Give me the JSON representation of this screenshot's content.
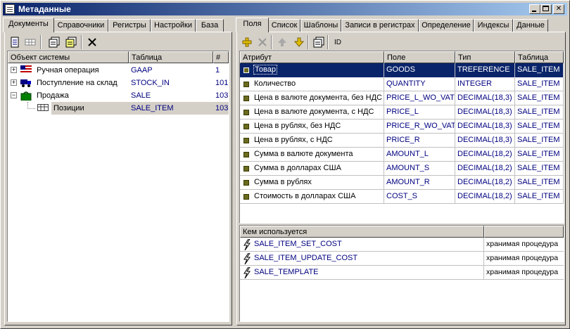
{
  "window": {
    "title": "Метаданные"
  },
  "left_tabs": [
    {
      "label": "Документы",
      "active": true
    },
    {
      "label": "Справочники"
    },
    {
      "label": "Регистры"
    },
    {
      "label": "Настройки"
    },
    {
      "label": "База"
    }
  ],
  "right_tabs": [
    {
      "label": "Поля",
      "active": true
    },
    {
      "label": "Список"
    },
    {
      "label": "Шаблоны"
    },
    {
      "label": "Записи в регистрах"
    },
    {
      "label": "Определение"
    },
    {
      "label": "Индексы"
    },
    {
      "label": "Данные"
    }
  ],
  "left_toolbar": [
    "new-document-icon",
    "grid-icon",
    "properties-icon",
    "properties-alt-icon",
    "delete-icon"
  ],
  "right_toolbar": {
    "icons": [
      "add-icon",
      "delete-icon",
      "move-up-icon",
      "move-down-icon",
      "properties-icon"
    ],
    "id_label": "ID"
  },
  "tree": {
    "headers": {
      "object": "Объект системы",
      "table": "Таблица",
      "num": "#"
    },
    "rows": [
      {
        "name": "Ручная операция",
        "table": "GAAP",
        "num": "1",
        "icon": "flag-icon",
        "level": 0,
        "expander": "+"
      },
      {
        "name": "Поступление на склад",
        "table": "STOCK_IN",
        "num": "101",
        "icon": "truck-icon",
        "level": 0,
        "expander": "+"
      },
      {
        "name": "Продажа",
        "table": "SALE",
        "num": "103",
        "icon": "bag-icon",
        "level": 0,
        "expander": "−"
      },
      {
        "name": "Позиции",
        "table": "SALE_ITEM",
        "num": "103",
        "icon": "table-icon",
        "level": 1,
        "selected": true
      }
    ]
  },
  "fields": {
    "headers": {
      "attribute": "Атрибут",
      "field": "Поле",
      "type": "Тип",
      "table": "Таблица"
    },
    "rows": [
      {
        "attribute": "Товар",
        "field": "GOODS",
        "type": "TREFERENCE",
        "table": "SALE_ITEM",
        "selected": true
      },
      {
        "attribute": "Количество",
        "field": "QUANTITY",
        "type": "INTEGER",
        "table": "SALE_ITEM"
      },
      {
        "attribute": "Цена в валюте документа, без НДС",
        "field": "PRICE_L_WO_VAT",
        "type": "DECIMAL(18,3)",
        "table": "SALE_ITEM"
      },
      {
        "attribute": "Цена в валюте документа, с НДС",
        "field": "PRICE_L",
        "type": "DECIMAL(18,3)",
        "table": "SALE_ITEM"
      },
      {
        "attribute": "Цена в рублях, без НДС",
        "field": "PRICE_R_WO_VAT",
        "type": "DECIMAL(18,3)",
        "table": "SALE_ITEM"
      },
      {
        "attribute": "Цена в рублях, с НДС",
        "field": "PRICE_R",
        "type": "DECIMAL(18,3)",
        "table": "SALE_ITEM"
      },
      {
        "attribute": "Сумма в валюте документа",
        "field": "AMOUNT_L",
        "type": "DECIMAL(18,2)",
        "table": "SALE_ITEM"
      },
      {
        "attribute": "Сумма в долларах США",
        "field": "AMOUNT_S",
        "type": "DECIMAL(18,2)",
        "table": "SALE_ITEM"
      },
      {
        "attribute": "Сумма в рублях",
        "field": "AMOUNT_R",
        "type": "DECIMAL(18,2)",
        "table": "SALE_ITEM"
      },
      {
        "attribute": "Стоимость в долларах США",
        "field": "COST_S",
        "type": "DECIMAL(18,2)",
        "table": "SALE_ITEM"
      }
    ]
  },
  "usage": {
    "header": "Кем используется",
    "rows": [
      {
        "name": "SALE_ITEM_SET_COST",
        "kind": "хранимая процедура"
      },
      {
        "name": "SALE_ITEM_UPDATE_COST",
        "kind": "хранимая процедура"
      },
      {
        "name": "SALE_TEMPLATE",
        "kind": "хранимая процедура"
      }
    ]
  },
  "colors": {
    "selection": "#0a246a",
    "db_text": "#000080",
    "title_start": "#0a246a",
    "title_end": "#a6caf0"
  }
}
